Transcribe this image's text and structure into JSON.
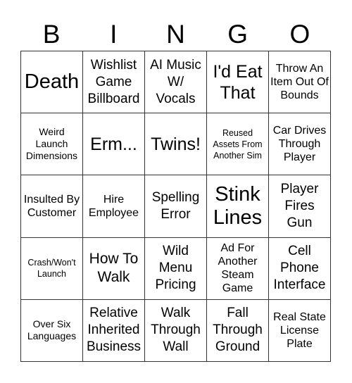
{
  "header": {
    "letters": [
      "B",
      "I",
      "N",
      "G",
      "O"
    ]
  },
  "cells": [
    {
      "text": "Death",
      "size": "s-xl"
    },
    {
      "text": "Wishlist Game Billboard",
      "size": "s-md"
    },
    {
      "text": "AI Music W/ Vocals",
      "size": "s-md"
    },
    {
      "text": "I'd Eat That",
      "size": "s-lg"
    },
    {
      "text": "Throw An Item Out Of Bounds",
      "size": "s-sm"
    },
    {
      "text": "Weird Launch Dimensions",
      "size": "s-xs"
    },
    {
      "text": "Erm...",
      "size": "s-lg"
    },
    {
      "text": "Twins!",
      "size": "s-lg"
    },
    {
      "text": "Reused Assets From Another Sim",
      "size": "s-xxs"
    },
    {
      "text": "Car Drives Through Player",
      "size": "s-sm"
    },
    {
      "text": "Insulted By Customer",
      "size": "s-sm"
    },
    {
      "text": "Hire Employee",
      "size": "s-sm"
    },
    {
      "text": "Spelling Error",
      "size": "s-md"
    },
    {
      "text": "Stink Lines",
      "size": "s-xl"
    },
    {
      "text": "Player Fires Gun",
      "size": "s-md"
    },
    {
      "text": "Crash/Won't Launch",
      "size": "s-xxs"
    },
    {
      "text": "How To Walk",
      "size": "s-l2"
    },
    {
      "text": "Wild Menu Pricing",
      "size": "s-md"
    },
    {
      "text": "Ad For Another Steam Game",
      "size": "s-sm"
    },
    {
      "text": "Cell Phone Interface",
      "size": "s-md"
    },
    {
      "text": "Over Six Languages",
      "size": "s-xs"
    },
    {
      "text": "Relative Inherited Business",
      "size": "s-md"
    },
    {
      "text": "Walk Through Wall",
      "size": "s-md"
    },
    {
      "text": "Fall Through Ground",
      "size": "s-md"
    },
    {
      "text": "Real State License Plate",
      "size": "s-sm"
    }
  ]
}
